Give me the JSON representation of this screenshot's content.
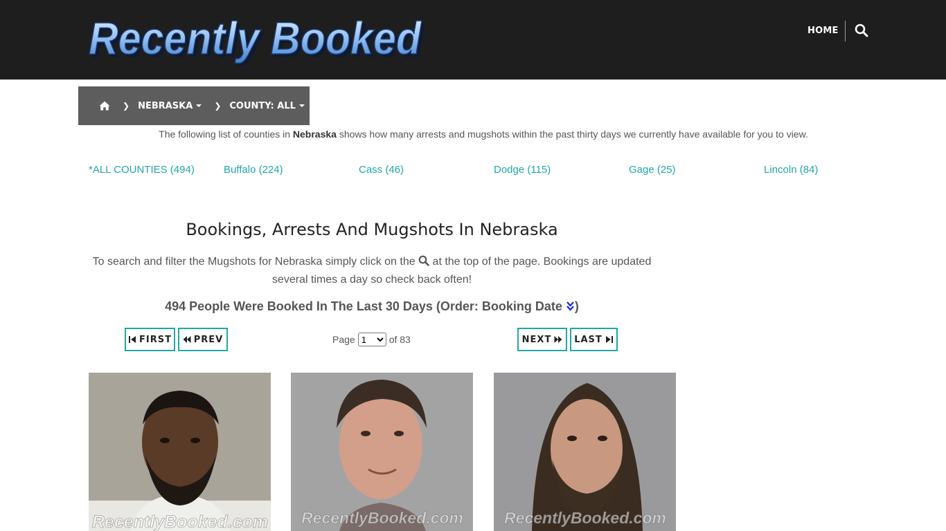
{
  "header": {
    "logo_text": "Recently Booked",
    "nav_home": "HOME",
    "search_icon": "search-icon"
  },
  "breadcrumb": {
    "home_icon": "home-icon",
    "state": "NEBRASKA",
    "county": "COUNTY: ALL"
  },
  "intro": {
    "before": "The following list of counties in ",
    "state": "Nebraska",
    "after": " shows how many arrests and mugshots within the past thirty days we currently have available for you to view."
  },
  "counties": [
    {
      "label": "*ALL COUNTIES (494)"
    },
    {
      "label": "Buffalo (224)"
    },
    {
      "label": "Cass (46)"
    },
    {
      "label": "Dodge (115)"
    },
    {
      "label": "Gage (25)"
    },
    {
      "label": "Lincoln (84)"
    }
  ],
  "main": {
    "title": "Bookings, Arrests And Mugshots In Nebraska",
    "desc_before": "To search and filter the Mugshots for Nebraska simply click on the",
    "desc_after": "at the top of the page. Bookings are updated several times a day so check back often!",
    "count_text": "494 People Were Booked In The Last 30 Days (Order: Booking Date",
    "count_close": ")"
  },
  "pagination": {
    "first": "FIRST",
    "prev": "PREV",
    "next": "NEXT",
    "last": "LAST",
    "page_label": "Page",
    "current_page": "1",
    "of_label": "of 83"
  },
  "mugshots": [
    {
      "watermark": "RecentlyBooked.com",
      "bg": "#a8a49a"
    },
    {
      "watermark": "RecentlyBooked.com",
      "bg": "#a3a3a3"
    },
    {
      "watermark": "RecentlyBooked.com",
      "bg": "#9a9a9c"
    }
  ],
  "colors": {
    "accent": "#20a6a6",
    "topbar": "#1e1e1e",
    "breadcrumb": "#5d5d5d",
    "sort_icon": "#1a2fd6"
  }
}
